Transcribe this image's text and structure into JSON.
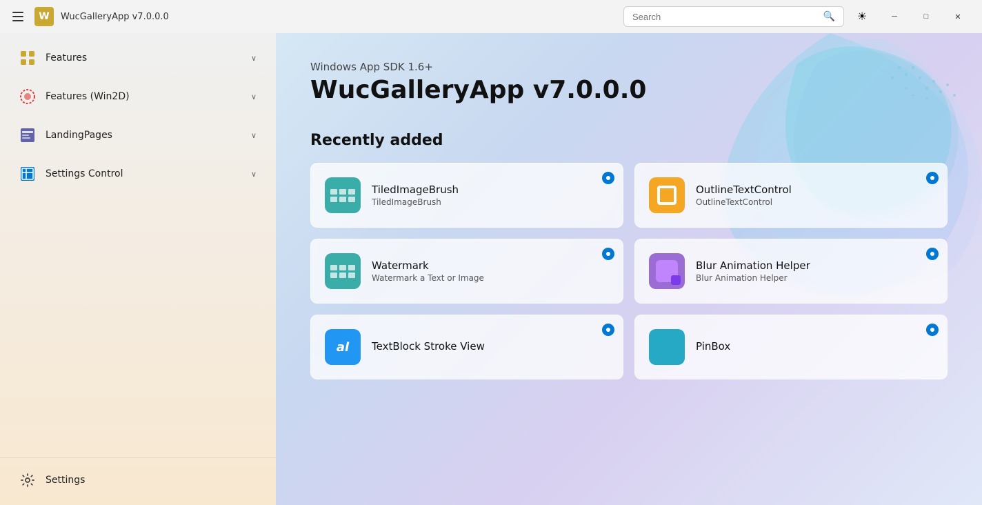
{
  "titlebar": {
    "app_name": "WucGalleryApp",
    "app_version": "v7.0.0.0",
    "app_title": "WucGalleryApp  v7.0.0.0",
    "search_placeholder": "Search",
    "theme_icon": "☀",
    "minimize_label": "─",
    "maximize_label": "□",
    "close_label": "✕"
  },
  "sidebar": {
    "items": [
      {
        "id": "features",
        "label": "Features",
        "has_chevron": true
      },
      {
        "id": "features-win2d",
        "label": "Features (Win2D)",
        "has_chevron": true
      },
      {
        "id": "landing-pages",
        "label": "LandingPages",
        "has_chevron": true
      },
      {
        "id": "settings-control",
        "label": "Settings Control",
        "has_chevron": true
      }
    ],
    "bottom_items": [
      {
        "id": "settings",
        "label": "Settings"
      }
    ]
  },
  "content": {
    "sdk_version": "Windows App SDK 1.6+",
    "headline": "WucGalleryApp v7.0.0.0",
    "recently_added_title": "Recently added",
    "cards": [
      {
        "id": "tiled-image-brush",
        "title": "TiledImageBrush",
        "subtitle": "TiledImageBrush",
        "icon_type": "tiled",
        "has_badge": true
      },
      {
        "id": "outline-text-control",
        "title": "OutlineTextControl",
        "subtitle": "OutlineTextControl",
        "icon_type": "outline",
        "has_badge": true
      },
      {
        "id": "watermark",
        "title": "Watermark",
        "subtitle": "Watermark a Text or Image",
        "icon_type": "watermark",
        "has_badge": true
      },
      {
        "id": "blur-animation-helper",
        "title": "Blur Animation Helper",
        "subtitle": "Blur Animation Helper",
        "icon_type": "blur",
        "has_badge": true
      },
      {
        "id": "textblock-stroke-view",
        "title": "TextBlock Stroke View",
        "subtitle": "",
        "icon_type": "textblock",
        "has_badge": true
      },
      {
        "id": "pinbox",
        "title": "PinBox",
        "subtitle": "",
        "icon_type": "pinbox",
        "has_badge": true
      }
    ]
  }
}
